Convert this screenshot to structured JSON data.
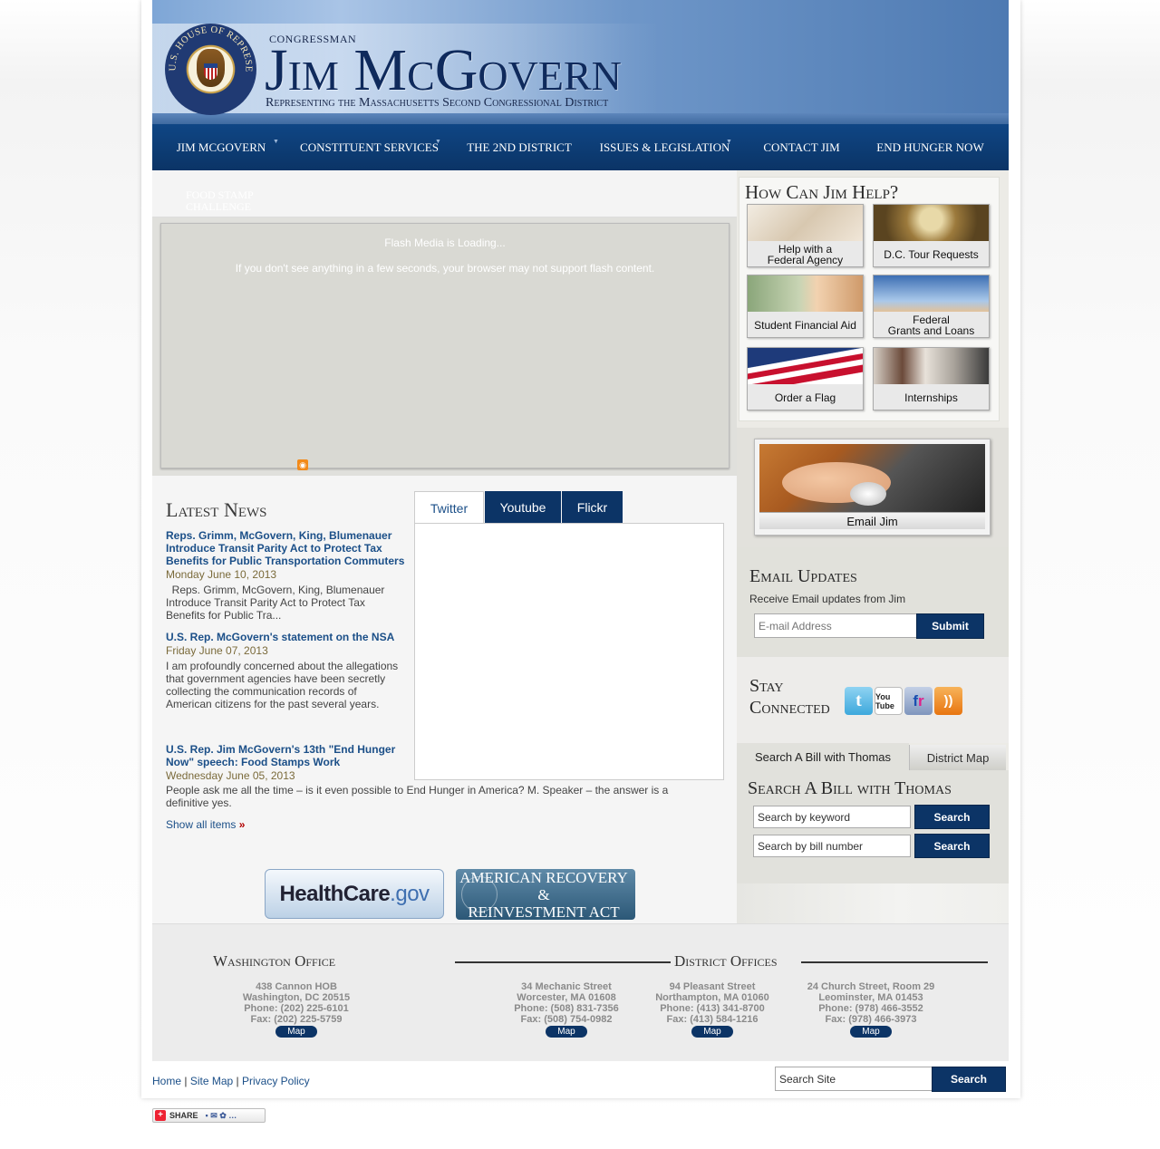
{
  "header": {
    "seal_text": "U.S. HOUSE OF REPRESENTATIVES",
    "congressman": "CONGRESSMAN",
    "name": "Jim McGovern",
    "tagline": "Representing the Massachusetts Second Congressional District"
  },
  "nav": [
    {
      "label": "Jim McGovern",
      "has_dropdown": true
    },
    {
      "label": "Constituent Services",
      "has_dropdown": true
    },
    {
      "label": "The 2nd District",
      "has_dropdown": false
    },
    {
      "label": "Issues & Legislation",
      "has_dropdown": true
    },
    {
      "label": "Contact Jim",
      "has_dropdown": false
    },
    {
      "label": "End Hunger Now",
      "has_dropdown": false
    }
  ],
  "subbar": {
    "ghost_label": "Food Stamp Challenge"
  },
  "flash": {
    "loading": "Flash Media is Loading...",
    "notice": "If you don't see anything in a few seconds, your browser may not support flash content."
  },
  "news": {
    "title": "Latest News",
    "items": [
      {
        "headline": "Reps. Grimm, McGovern, King, Blumenauer Introduce Transit Parity Act to Protect Tax Benefits for Public Transportation Commuters",
        "date": "Monday June 10, 2013",
        "summary": "  Reps. Grimm, McGovern, King, Blumenauer Introduce Transit Parity Act to Protect Tax Benefits for Public Tra..."
      },
      {
        "headline": "U.S. Rep. McGovern's statement on the NSA",
        "date": "Friday June 07, 2013",
        "summary": "I am profoundly concerned about the allegations that government agencies have been secretly collecting the communication records of American citizens for the past several years."
      },
      {
        "headline": "U.S. Rep. Jim McGovern's 13th \"End Hunger Now\" speech: Food Stamps Work",
        "date": "Wednesday June 05, 2013",
        "summary": "People ask me all the time – is it even possible to End Hunger in America? M. Speaker – the answer is a definitive yes."
      }
    ],
    "show_all": "Show all items",
    "show_all_arrow": "»"
  },
  "social_tabs": {
    "items": [
      "Twitter",
      "Youtube",
      "Flickr"
    ],
    "active": "Twitter"
  },
  "logos": {
    "healthcare": {
      "part1": "HealthCare",
      "part2": ".gov"
    },
    "arra": {
      "line1": "AMERICAN RECOVERY &",
      "line2": "REINVESTMENT ACT"
    }
  },
  "help": {
    "title": "How Can Jim Help?",
    "tiles": [
      {
        "label_line1": "Help with a",
        "label_line2": "Federal Agency",
        "icon": "documents-photo-icon"
      },
      {
        "label_line1": "D.C. Tour Requests",
        "label_line2": "",
        "icon": "capitol-dome-icon"
      },
      {
        "label_line1": "Student Financial Aid",
        "label_line2": "",
        "icon": "money-student-icon"
      },
      {
        "label_line1": "Federal",
        "label_line2": "Grants and Loans",
        "icon": "handshake-icon"
      },
      {
        "label_line1": "Order a Flag",
        "label_line2": "",
        "icon": "flag-icon"
      },
      {
        "label_line1": "Internships",
        "label_line2": "",
        "icon": "intern-photo-icon"
      }
    ]
  },
  "email_jim": {
    "label": "Email Jim"
  },
  "updates": {
    "title": "Email Updates",
    "subtitle": "Receive Email updates from Jim",
    "placeholder": "E-mail Address",
    "submit": "Submit"
  },
  "stay": {
    "line1": "Stay",
    "line2": "Connected",
    "icons": [
      {
        "name": "twitter-icon",
        "glyph": "t",
        "color": "#58b7e6"
      },
      {
        "name": "youtube-icon",
        "glyph": "You Tube",
        "color": "#c4302b"
      },
      {
        "name": "flickr-icon",
        "glyph": "fr",
        "color": "#8aa0c4"
      },
      {
        "name": "rss-icon",
        "glyph": "))",
        "color": "#f08a1c"
      }
    ]
  },
  "bill": {
    "tab1": "Search A Bill with Thomas",
    "tab2": "District Map",
    "title": "Search A Bill with Thomas",
    "keyword_value": "Search by keyword",
    "number_value": "Search by bill number",
    "search": "Search"
  },
  "footer": {
    "washington": {
      "title": "Washington Office",
      "lines": [
        "438 Cannon HOB",
        "Washington, DC 20515",
        "Phone: (202) 225-6101",
        "Fax: (202) 225-5759"
      ]
    },
    "district_title": "District Offices",
    "districts": [
      {
        "lines": [
          "34 Mechanic Street",
          "Worcester, MA 01608",
          "Phone: (508) 831-7356",
          "Fax: (508) 754-0982"
        ]
      },
      {
        "lines": [
          "94 Pleasant Street",
          "Northampton, MA 01060",
          "Phone: (413) 341-8700",
          "Fax: (413) 584-1216"
        ]
      },
      {
        "lines": [
          "24 Church Street, Room 29",
          "Leominster, MA 01453",
          "Phone: (978) 466-3552",
          "Fax: (978) 466-3973"
        ]
      }
    ],
    "map": "Map"
  },
  "bottom": {
    "links": [
      "Home",
      "Site Map",
      "Privacy Policy"
    ],
    "separator": "|",
    "site_search_value": "Search Site",
    "search": "Search",
    "share": "SHARE"
  }
}
